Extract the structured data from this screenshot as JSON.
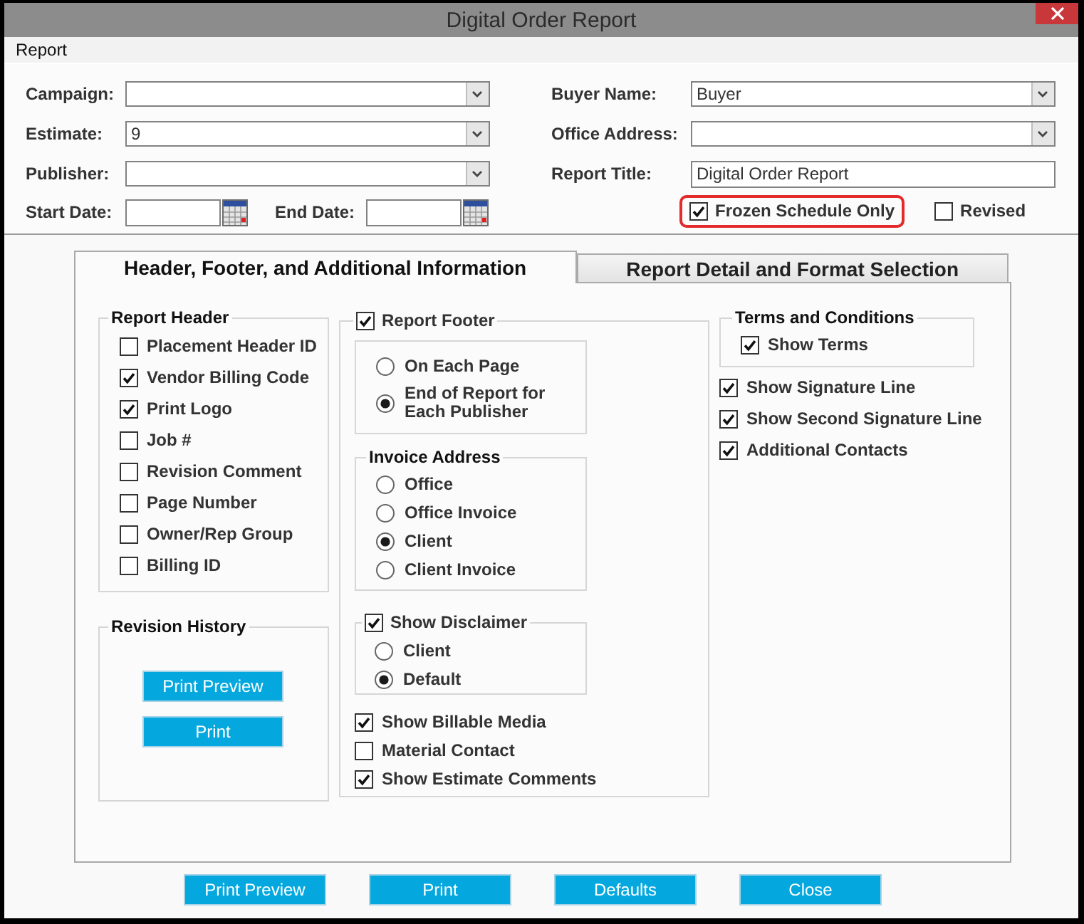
{
  "window": {
    "title": "Digital Order Report"
  },
  "menu": [
    {
      "label": "Report"
    }
  ],
  "criteria": {
    "left": [
      {
        "label": "Campaign:",
        "kind": "dropdown"
      },
      {
        "label": "Estimate:",
        "kind": "dropdown",
        "value": "9"
      },
      {
        "label": "Publisher:",
        "kind": "dropdown"
      }
    ],
    "dates": [
      {
        "label": "Start Date:"
      },
      {
        "label": "End Date:"
      }
    ],
    "right": [
      {
        "label": "Buyer Name:",
        "kind": "dropdown",
        "value": "Buyer"
      },
      {
        "label": "Office Address:",
        "kind": "dropdown"
      },
      {
        "label": "Report Title:",
        "kind": "text",
        "value": "Digital Order Report"
      }
    ],
    "options": [
      {
        "label": "Frozen Schedule Only",
        "checked": true,
        "highlighted": true
      },
      {
        "label": "Revised",
        "checked": false,
        "highlighted": false
      }
    ]
  },
  "tabs": [
    {
      "label": "Header, Footer, and Additional Information",
      "selected": true
    },
    {
      "label": "Report Detail and Format Selection",
      "selected": false
    }
  ],
  "report_header": {
    "title": "Report Header",
    "items": [
      {
        "label": "Placement Header ID",
        "checked": false
      },
      {
        "label": "Vendor Billing Code",
        "checked": true
      },
      {
        "label": "Print Logo",
        "checked": true
      },
      {
        "label": "Job #",
        "checked": false
      },
      {
        "label": "Revision Comment",
        "checked": false
      },
      {
        "label": "Page Number",
        "checked": false
      },
      {
        "label": "Owner/Rep Group",
        "checked": false
      },
      {
        "label": "Billing ID",
        "checked": false
      }
    ]
  },
  "revision_history": {
    "title": "Revision History",
    "buttons": [
      "Print Preview",
      "Print"
    ]
  },
  "report_footer": {
    "label": "Report Footer",
    "checked": true,
    "placement": [
      {
        "label": "On Each Page",
        "selected": false
      },
      {
        "label": "End of Report for Each Publisher",
        "selected": true
      }
    ]
  },
  "invoice_address": {
    "title": "Invoice Address",
    "options": [
      {
        "label": "Office",
        "selected": false
      },
      {
        "label": "Office Invoice",
        "selected": false
      },
      {
        "label": "Client",
        "selected": true
      },
      {
        "label": "Client Invoice",
        "selected": false
      }
    ]
  },
  "disclaimer": {
    "label": "Show Disclaimer",
    "checked": true,
    "options": [
      {
        "label": "Client",
        "selected": false
      },
      {
        "label": "Default",
        "selected": true
      }
    ]
  },
  "extra_options": [
    {
      "label": "Show Billable Media",
      "checked": true
    },
    {
      "label": "Material Contact",
      "checked": false
    },
    {
      "label": "Show Estimate Comments",
      "checked": true
    }
  ],
  "terms": {
    "title": "Terms and Conditions",
    "items": [
      {
        "label": "Show Terms",
        "checked": true
      }
    ]
  },
  "signature_options": [
    {
      "label": "Show Signature Line",
      "checked": true
    },
    {
      "label": "Show Second Signature Line",
      "checked": true
    },
    {
      "label": "Additional Contacts",
      "checked": true
    }
  ],
  "buttons": [
    "Print Preview",
    "Print",
    "Defaults",
    "Close"
  ]
}
